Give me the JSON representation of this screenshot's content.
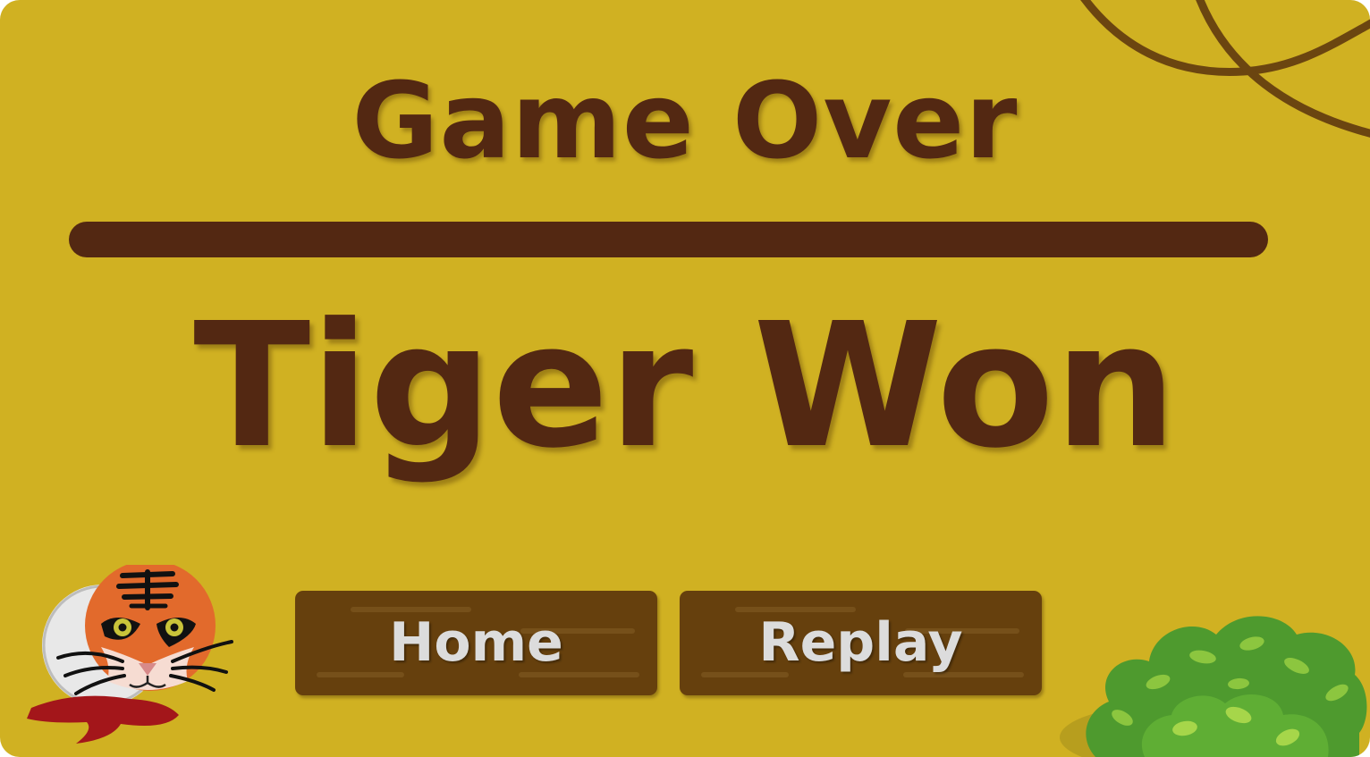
{
  "game_over": {
    "title": "Game Over",
    "result": "Tiger Won"
  },
  "buttons": {
    "home_label": "Home",
    "replay_label": "Replay"
  },
  "colors": {
    "panel": "#d0b122",
    "text": "#532812",
    "button": "#66400d",
    "button_text": "#dcdcdc"
  },
  "icons": [
    "vine-decoration",
    "tiger-face-icon",
    "bush-decoration"
  ]
}
